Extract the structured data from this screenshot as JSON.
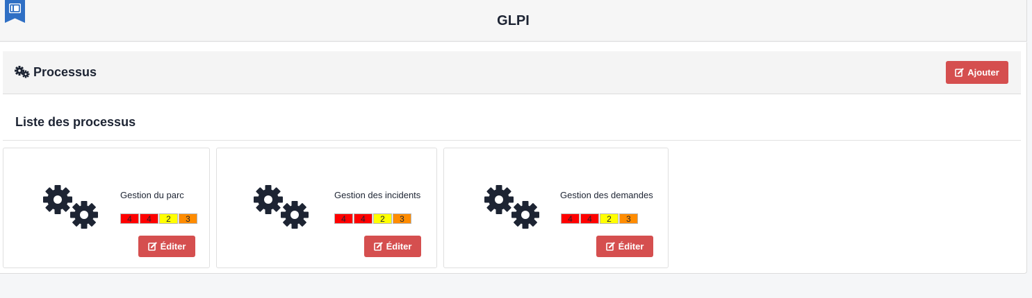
{
  "header": {
    "title": "GLPI",
    "menu_icon": "bookmark-toggle-icon"
  },
  "section": {
    "title": "Processus",
    "icon": "cogs-icon",
    "add_label": "Ajouter"
  },
  "list": {
    "title": "Liste des processus"
  },
  "colors": {
    "critical": "#ff0000",
    "medium": "#ffff00",
    "high": "#ff8c00",
    "button": "#d54f4f"
  },
  "cards": [
    {
      "name": "Gestion du parc",
      "levels": [
        "4",
        "4",
        "2",
        "3"
      ],
      "edit_label": "Éditer"
    },
    {
      "name": "Gestion des incidents",
      "levels": [
        "4",
        "4",
        "2",
        "3"
      ],
      "edit_label": "Éditer"
    },
    {
      "name": "Gestion des demandes",
      "levels": [
        "4",
        "4",
        "2",
        "3"
      ],
      "edit_label": "Éditer"
    }
  ]
}
